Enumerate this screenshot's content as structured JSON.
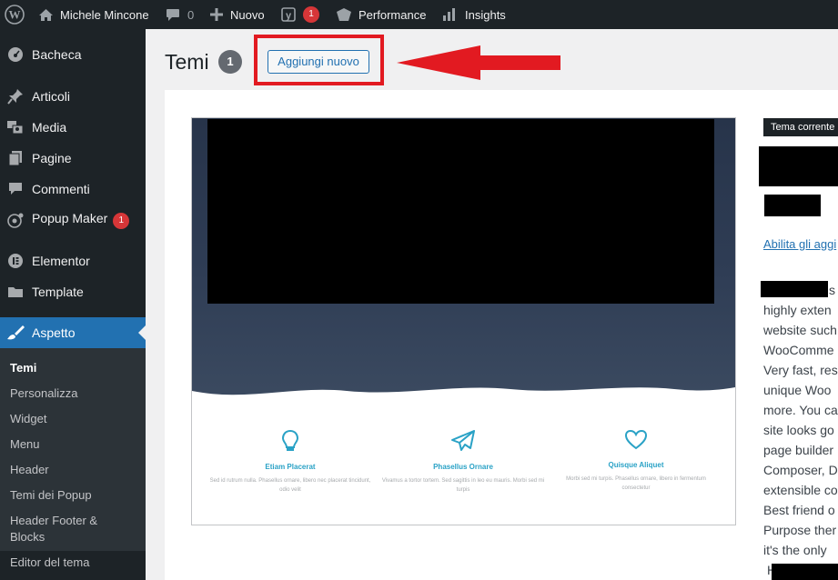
{
  "admin_bar": {
    "site_name": "Michele Mincone",
    "comments_count": "0",
    "new_label": "Nuovo",
    "yoast_badge": "1",
    "performance_label": "Performance",
    "insights_label": "Insights"
  },
  "sidebar": {
    "items": [
      {
        "label": "Bacheca",
        "icon": "dashboard-icon"
      },
      {
        "label": "Articoli",
        "icon": "pin-icon"
      },
      {
        "label": "Media",
        "icon": "media-icon"
      },
      {
        "label": "Pagine",
        "icon": "pages-icon"
      },
      {
        "label": "Commenti",
        "icon": "comments-icon"
      },
      {
        "label": "Popup Maker",
        "icon": "popup-icon",
        "badge": "1"
      },
      {
        "label": "Elementor",
        "icon": "elementor-icon"
      },
      {
        "label": "Template",
        "icon": "folder-icon"
      },
      {
        "label": "Aspetto",
        "icon": "brush-icon"
      }
    ],
    "submenu": [
      "Temi",
      "Personalizza",
      "Widget",
      "Menu",
      "Header",
      "Temi dei Popup",
      "Header Footer & Blocks",
      "Editor del tema"
    ]
  },
  "main": {
    "title": "Temi",
    "count": "1",
    "add_new_label": "Aggiungi nuovo",
    "current_theme_badge": "Tema corrente",
    "enable_link": "Abilita gli aggi",
    "description_lines": [
      "s",
      "highly exten",
      "website such",
      "WooComme",
      "Very fast, res",
      "unique Woo",
      "more. You ca",
      "site looks go",
      "page builder",
      "Composer, D",
      "extensible co",
      "Best friend o",
      "Purpose ther",
      "it's the only",
      "H"
    ]
  },
  "theme_preview": {
    "features": [
      {
        "title": "Etiam Placerat",
        "text": "Sed id rutrum nulla. Phasellus ornare, libero nec placerat tincidunt, odio velit",
        "icon": "bulb-icon"
      },
      {
        "title": "Phasellus Ornare",
        "text": "Vivamus a tortor tortem. Sed sagittis in leo eu mauris. Morbi sed mi turpis",
        "icon": "paper-plane-icon"
      },
      {
        "title": "Quisque Aliquet",
        "text": "Morbi sed mi turpis. Phasellus ornare, libero in fermentum consectetur",
        "icon": "heart-icon"
      }
    ]
  },
  "colors": {
    "admin_bar": "#1d2327",
    "active_menu": "#2271b1",
    "highlight": "#e21a21",
    "accent_blue": "#2aa2c6"
  }
}
